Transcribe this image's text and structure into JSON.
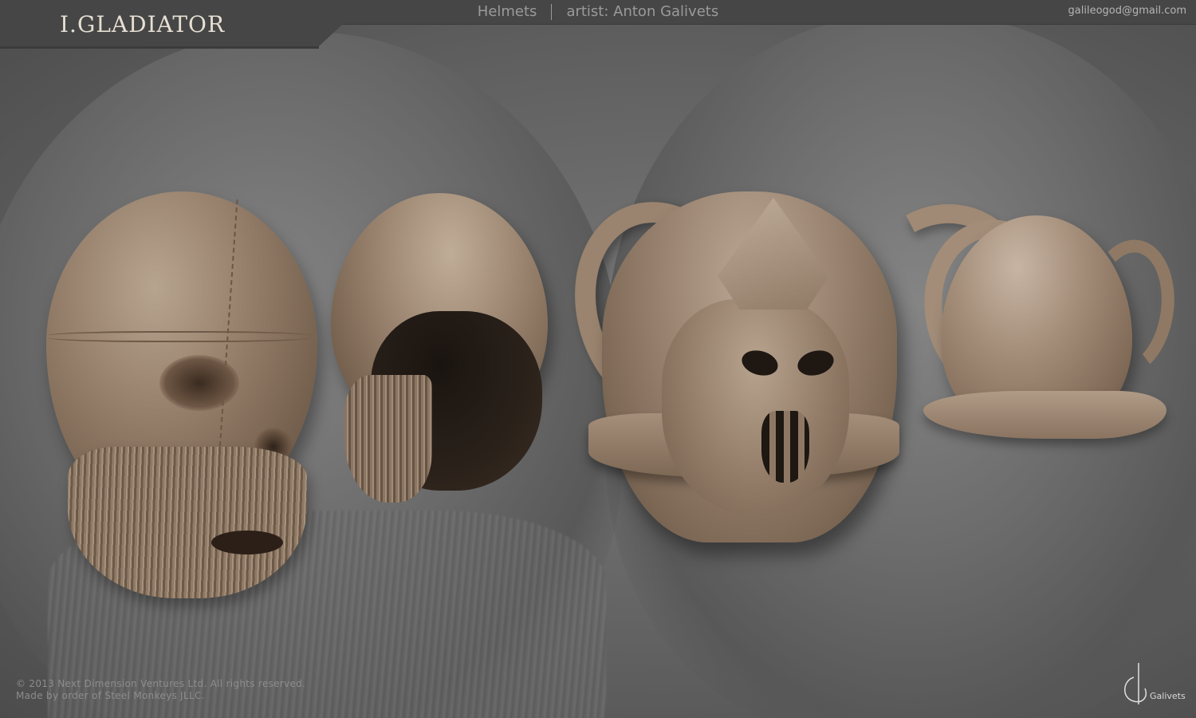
{
  "header": {
    "logo_title": "I.GLADIATOR",
    "section": "Helmets",
    "artist": "artist: Anton Galivets",
    "email": "galileogod@gmail.com"
  },
  "footer": {
    "copyright_line1": "© 2013 Next Dimension Ventures Ltd. All rights reserved.",
    "copyright_line2": "Made by order of Steel Monkeys JLLC.",
    "signature": "Galivets"
  },
  "colors": {
    "header_bg": "#464646",
    "background": "#626262",
    "sculpt": "#9a8470",
    "title_text": "#e6dfd3"
  }
}
